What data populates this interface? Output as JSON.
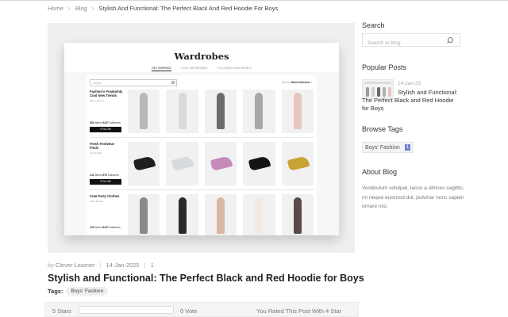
{
  "breadcrumb": {
    "home": "Home",
    "blog": "Blog",
    "current": "Stylish And Functional: The Perfect Black And Red Hoodie For Boys"
  },
  "hero": {
    "title": "Wardrobes",
    "tabs": [
      "GET INSPIRED",
      "YOUR WARDROBES",
      "FOLLOWED WARDROBES"
    ],
    "search_placeholder": "Search",
    "sort_label": "Sort by",
    "sort_value": "Most followed",
    "rows": [
      {
        "title": "Fashion's Freakishly Cool New Trends",
        "sub": "Elsa Jacquins",
        "items": "653",
        "followers": "9427",
        "button": "FOLLOW",
        "thumb_colors": [
          "#b9b9b9",
          "#d9d9d9",
          "#6b6b6b",
          "#a8a8a8",
          "#e6c6c0"
        ]
      },
      {
        "title": "Fresh Footwear Finds",
        "sub": "Conal Mata",
        "items": "242",
        "followers": "876",
        "button": "FOLLOW",
        "thumb_colors": [
          "#1f1f1f",
          "#d7dadf",
          "#c58ab8",
          "#141414",
          "#c9a235"
        ]
      },
      {
        "title": "Cute Party Clothes",
        "sub": "Inbar Wardle",
        "items": "190",
        "followers": "8427",
        "button": "",
        "thumb_colors": [
          "#8a8a8a",
          "#2b2b2b",
          "#d9b7a6",
          "#f0ebe6",
          "#5a4a48"
        ]
      }
    ],
    "items_label": "items",
    "followers_label": "followers"
  },
  "post": {
    "by_label": "by",
    "author": "Clever Learner",
    "date": "14-Jan-2025",
    "comments": "1",
    "title": "Stylish and Functional: The Perfect Black and Red Hoodie for Boys",
    "tags_label": "Tags:",
    "tag": "Boys' Fashion"
  },
  "rating": {
    "stars_label": "5 Stars",
    "fill": 0,
    "votes": "0 Vote",
    "rated_text": "You Rated This Post With 4 Star"
  },
  "sidebar": {
    "search_heading": "Search",
    "search_placeholder": "Search in blog",
    "popular_heading": "Popular Posts",
    "popular_date": "14-Jan-25",
    "popular_title": "Stylish and Functional: The Perfect Black and Red Hoodie for Boys",
    "tags_heading": "Browse Tags",
    "tag_name": "Boys' Fashion",
    "tag_count": "1",
    "about_heading": "About Blog",
    "about_text": "Vestibulum volutpat, lacus a ultrices sagittis, mi neque euismod dui, pulvinar nunc sapien ornare nisl."
  },
  "colors": {
    "accent": "#6f7fd8",
    "text": "#333333",
    "muted": "#888888"
  }
}
